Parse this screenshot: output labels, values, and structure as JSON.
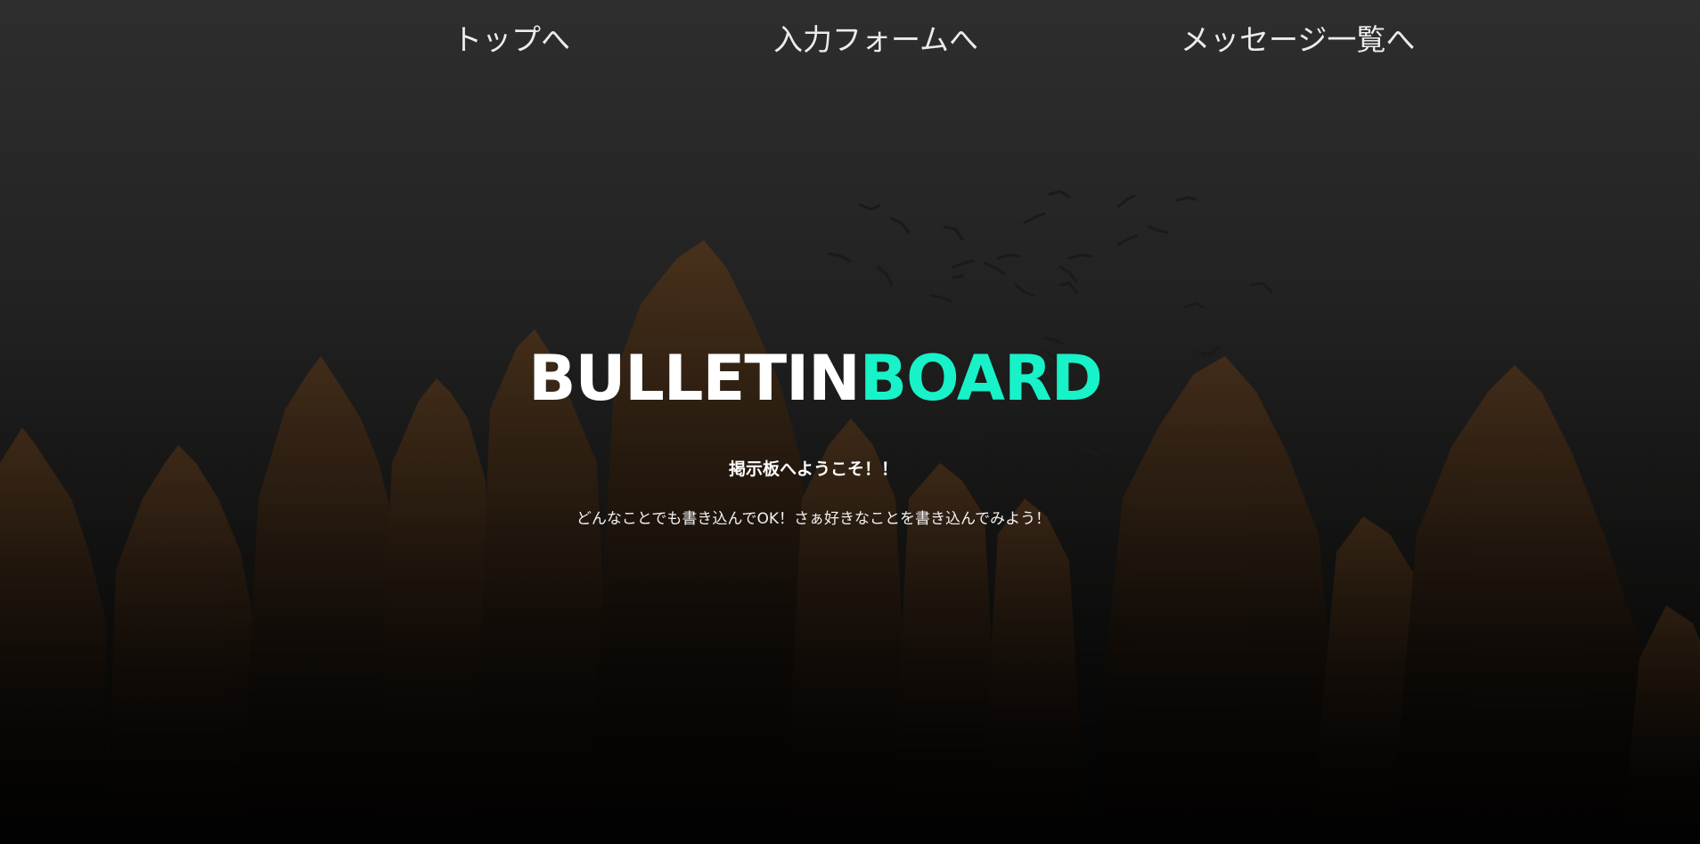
{
  "nav": {
    "top_label": "トップへ",
    "form_label": "入力フォームへ",
    "list_label": "メッセージ一覧へ"
  },
  "hero": {
    "title_part1": "BULLETIN",
    "title_part2": "BOARD",
    "subtitle": "掲示板へようこそ！！",
    "description": "どんなことでも書き込んでOK！さぁ好きなことを書き込んでみよう！"
  },
  "colors": {
    "background": "#2d2d2d",
    "accent": "#17f2c8",
    "text": "#ffffff"
  },
  "background_image": {
    "icon": "forest-with-birds-silhouette"
  }
}
